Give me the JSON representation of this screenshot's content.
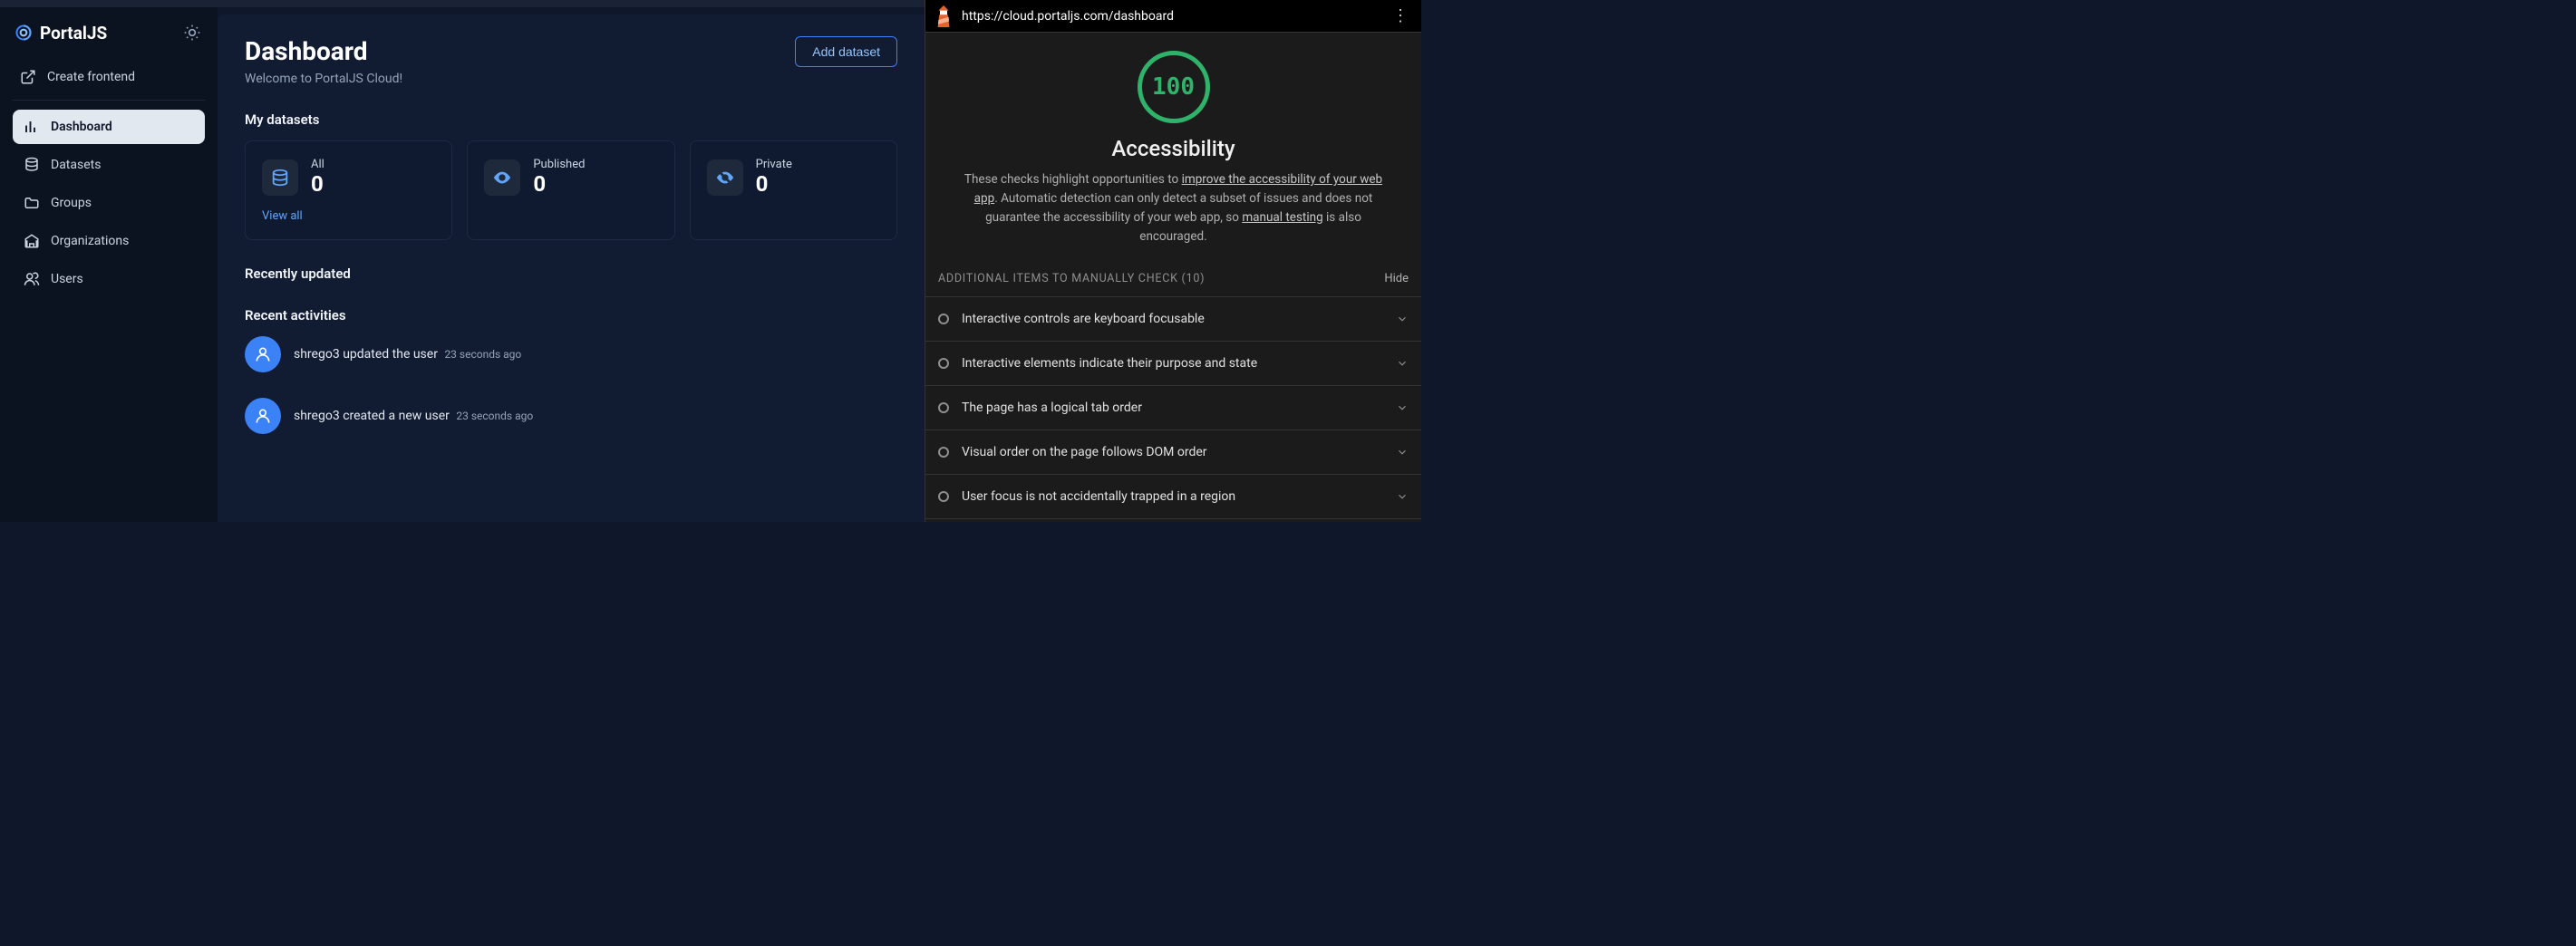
{
  "brand": {
    "name": "PortalJS"
  },
  "sidebar": {
    "create_label": "Create frontend",
    "items": [
      {
        "label": "Dashboard"
      },
      {
        "label": "Datasets"
      },
      {
        "label": "Groups"
      },
      {
        "label": "Organizations"
      },
      {
        "label": "Users"
      }
    ]
  },
  "header": {
    "title": "Dashboard",
    "welcome": "Welcome to PortalJS Cloud!",
    "add_dataset": "Add dataset"
  },
  "datasets": {
    "section_title": "My datasets",
    "cards": [
      {
        "label": "All",
        "value": "0"
      },
      {
        "label": "Published",
        "value": "0"
      },
      {
        "label": "Private",
        "value": "0"
      }
    ],
    "view_all": "View all"
  },
  "recently_updated": {
    "title": "Recently updated"
  },
  "recent_activities": {
    "title": "Recent activities",
    "items": [
      {
        "user": "shrego3",
        "action": "updated the user",
        "time": "23 seconds ago"
      },
      {
        "user": "shrego3",
        "action": "created a new user",
        "time": "23 seconds ago"
      }
    ]
  },
  "devtools": {
    "url": "https://cloud.portaljs.com/dashboard",
    "score": "100",
    "score_title": "Accessibility",
    "desc_prefix": "These checks highlight opportunities to ",
    "desc_link1": "improve the accessibility of your web app",
    "desc_mid": ". Automatic detection can only detect a subset of issues and does not guarantee the accessibility of your web app, so ",
    "desc_link2": "manual testing",
    "desc_suffix": " is also encouraged.",
    "section_label": "ADDITIONAL ITEMS TO MANUALLY CHECK ",
    "section_count": "(10)",
    "hide_label": "Hide",
    "items": [
      {
        "label": "Interactive controls are keyboard focusable"
      },
      {
        "label": "Interactive elements indicate their purpose and state"
      },
      {
        "label": "The page has a logical tab order"
      },
      {
        "label": "Visual order on the page follows DOM order"
      },
      {
        "label": "User focus is not accidentally trapped in a region"
      }
    ]
  }
}
